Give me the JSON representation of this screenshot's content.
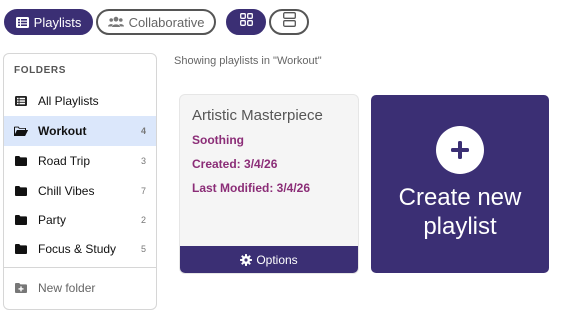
{
  "tabs": {
    "playlists": "Playlists",
    "collaborative": "Collaborative"
  },
  "sidebar": {
    "title": "FOLDERS",
    "items": [
      {
        "label": "All Playlists",
        "count": "",
        "icon": "list-icon"
      },
      {
        "label": "Workout",
        "count": "4",
        "icon": "folder-open-icon",
        "active": true
      },
      {
        "label": "Road Trip",
        "count": "3",
        "icon": "folder-icon"
      },
      {
        "label": "Chill Vibes",
        "count": "7",
        "icon": "folder-icon"
      },
      {
        "label": "Party",
        "count": "2",
        "icon": "folder-icon"
      },
      {
        "label": "Focus & Study",
        "count": "5",
        "icon": "folder-icon"
      }
    ],
    "new_folder": "New folder"
  },
  "main": {
    "showing_text": "Showing playlists in \"Workout\"",
    "playlist_card": {
      "title": "Artistic Masterpiece",
      "mood": "Soothing",
      "created": "Created: 3/4/26",
      "modified": "Last Modified: 3/4/26",
      "options_label": "Options"
    },
    "create_card": {
      "label_line1": "Create new",
      "label_line2": "playlist"
    }
  },
  "colors": {
    "primary": "#3b2f74",
    "accent_text": "#8b2d77",
    "active_row": "#dbe7fb"
  }
}
